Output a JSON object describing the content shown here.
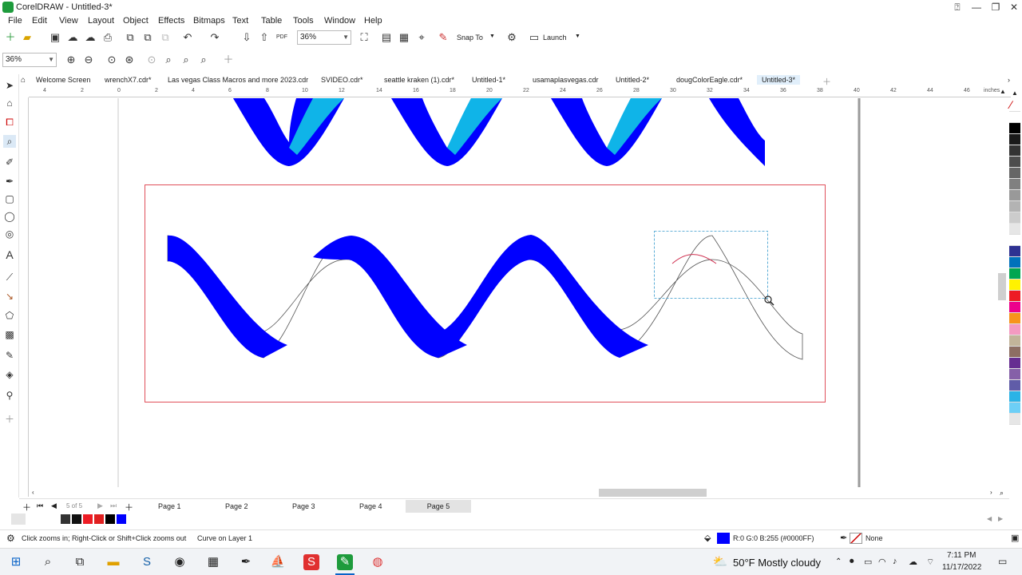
{
  "window": {
    "title": "CorelDRAW - Untitled-3*"
  },
  "menu": [
    "File",
    "Edit",
    "View",
    "Layout",
    "Object",
    "Effects",
    "Bitmaps",
    "Text",
    "Table",
    "Tools",
    "Window",
    "Help"
  ],
  "toolbar": {
    "zoom_value": "36%",
    "snap_to": "Snap To",
    "launch": "Launch",
    "pdf": "PDF"
  },
  "property_bar": {
    "zoom_value": "36%"
  },
  "tabs": [
    "Welcome Screen",
    "wrenchX7.cdr*",
    "Las vegas Class Macros and more 2023.cdr",
    "SVIDEO.cdr*",
    "seattle kraken (1).cdr*",
    "Untitled-1*",
    "usamaplasvegas.cdr",
    "Untitled-2*",
    "dougColorEagle.cdr*",
    "Untitled-3*"
  ],
  "active_tab": "Untitled-3*",
  "ruler": {
    "unit": "inches",
    "ticks": [
      "4",
      "2",
      "0",
      "2",
      "4",
      "6",
      "8",
      "10",
      "12",
      "14",
      "16",
      "18",
      "20",
      "22",
      "24",
      "26",
      "28",
      "30",
      "32",
      "34",
      "36",
      "38",
      "40",
      "42",
      "44",
      "46"
    ]
  },
  "pages": {
    "counter": "5 of 5",
    "items": [
      "Page 1",
      "Page 2",
      "Page 3",
      "Page 4",
      "Page 5"
    ],
    "active": "Page 5"
  },
  "status": {
    "hint": "Click zooms in; Right-Click or Shift+Click zooms out",
    "object": "Curve on Layer 1",
    "fill_value": "R:0 G:0 B:255 (#0000FF)",
    "outline_value": "None"
  },
  "colors": {
    "fill_blue": "#0000FF",
    "cyan": "#0fb4e8",
    "page_border": "#e0505a",
    "selection": "#3399cc"
  },
  "palette": [
    "#ffffff",
    "#000000",
    "#1a1a1a",
    "#333333",
    "#4d4d4d",
    "#666666",
    "#808080",
    "#999999",
    "#b3b3b3",
    "#cccccc",
    "#e6e6e6",
    "#ffffff",
    "#2e3192",
    "#0071bc",
    "#00a651",
    "#fff200",
    "#ed1c24",
    "#ec008c",
    "#f7941d",
    "#f49ac1",
    "#c2b49a",
    "#8d6e63",
    "#662d91",
    "#8560a8",
    "#605ca8",
    "#2bb3e6",
    "#6dcff6",
    "#e6e6e6"
  ],
  "taskbar": {
    "weather": "50°F  Mostly cloudy",
    "time": "7:11 PM",
    "date": "11/17/2022"
  }
}
